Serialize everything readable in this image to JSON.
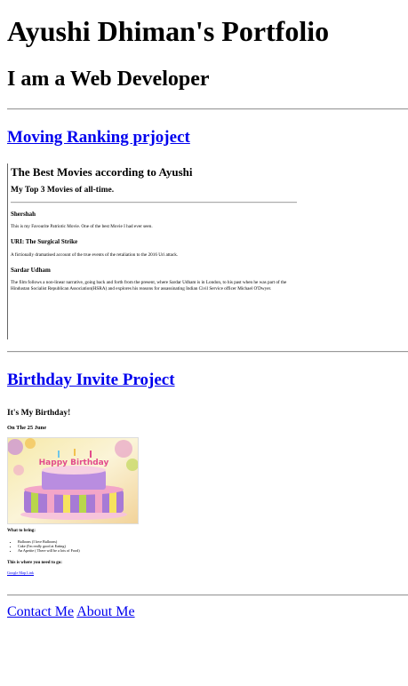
{
  "header": {
    "title": "Ayushi Dhiman's Portfolio",
    "subtitle": "I am a Web Developer"
  },
  "projects": [
    {
      "link_label": "Moving Ranking prjoject",
      "preview": {
        "heading": "The Best Movies according to Ayushi",
        "subheading": "My Top 3 Movies of all-time.",
        "movies": [
          {
            "title": "Shershah",
            "description": "This is my Favourite Patriotic Movie. One of the best Movie I had ever seen."
          },
          {
            "title": "URI: The Surgical Strike",
            "description": "A fictionally dramatised account of the true events of the retaliation to the 2016 Uri attack."
          },
          {
            "title": "Sardar Udham",
            "description": "The film follows a non-linear narrative, going back and forth from the present, where Sardar Udham is in London, to his past when he was part of the Hindustan Socialist Republican Association(HSRA) and explores his reasons for assassinating Indian Civil Service officer Michael O'Dwyer."
          }
        ]
      }
    },
    {
      "link_label": "Birthday Invite Project",
      "preview": {
        "heading": "It's My Birthday!",
        "date": "On The 25 June",
        "bring_heading": "What to bring:",
        "bring_items": [
          "Balloons (I love Balloons)",
          "Cake (I'm really good at Eating)",
          "An Apetite ( There will be a lots of Food)"
        ],
        "where_heading": "This is where you need to go:",
        "map_link": "Google Map Link",
        "cake_text": "Happy Birthday"
      }
    }
  ],
  "footer": {
    "contact_label": "Contact Me",
    "about_label": "About Me"
  },
  "colors": {
    "link": "#0000ee",
    "rule": "#9a9a9a",
    "cake_purple": "#a77ad6",
    "cake_pink": "#f3a5c8",
    "cake_green": "#b9d64b"
  }
}
